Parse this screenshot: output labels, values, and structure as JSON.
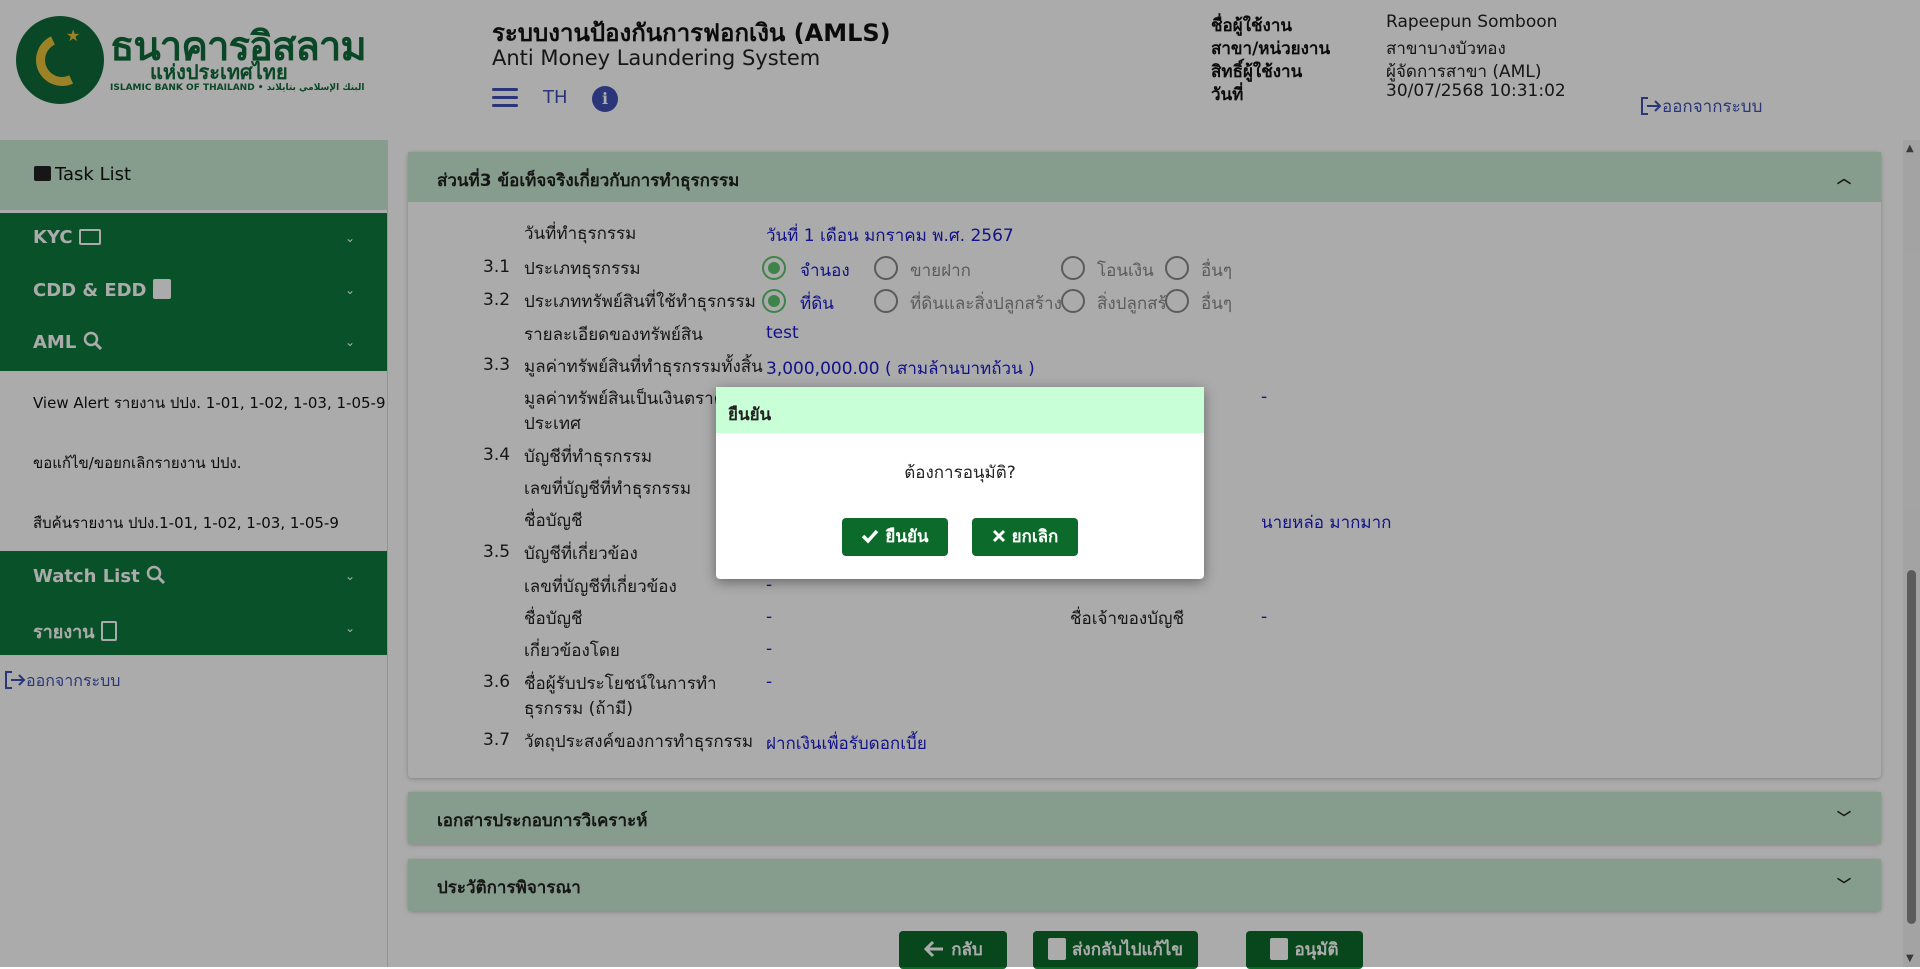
{
  "header": {
    "bank_name_th": "ธนาคารอิสลาม",
    "bank_name_th2": "แห่งประเทศไทย",
    "bank_name_en": "ISLAMIC BANK OF THAILAND • البنك الإسلامي بتايلاند",
    "system_title": "ระบบงานป้องกันการฟอกเงิน (AMLS)",
    "system_subtitle": "Anti Money Laundering System",
    "lang": "TH",
    "info": "i",
    "user_label": "ชื่อผู้ใช้งาน",
    "user_value": "Rapeepun Somboon",
    "branch_label": "สาขา/หน่วยงาน",
    "branch_value": "สาขาบางบัวทอง",
    "role_label": "สิทธิ์ผู้ใช้งาน",
    "role_value": "ผู้จัดการสาขา (AML)",
    "date_label": "วันที่",
    "date_value": "30/07/2568 10:31:02",
    "logout": "ออกจากระบบ"
  },
  "sidebar": {
    "task_list": "Task List",
    "kyc": "KYC",
    "cdd": "CDD & EDD",
    "aml": "AML",
    "aml_items": [
      "View Alert รายงาน ปปง. 1-01, 1-02, 1-03, 1-05-9",
      "ขอแก้ไข/ขอยกเลิกรายงาน ปปง.",
      "สืบค้นรายงาน ปปง.1-01, 1-02, 1-03, 1-05-9"
    ],
    "watch_list": "Watch List",
    "report": "รายงาน",
    "logout": "ออกจากระบบ",
    "chevron": "⌄"
  },
  "section3": {
    "title": "ส่วนที่3 ข้อเท็จจริงเกี่ยวกับการทำธุรกรรม",
    "chev_up": "︿",
    "date_label": "วันที่ทำธุรกรรม",
    "date_value": "วันที่ 1 เดือน มกราคม พ.ศ. 2567",
    "n31": "3.1",
    "l31": "ประเภทธุรกรรม",
    "r31": [
      "จำนอง",
      "ขายฝาก",
      "โอนเงิน",
      "อื่นๆ"
    ],
    "n32": "3.2",
    "l32": "ประเภททรัพย์สินที่ใช้ทำธุรกรรม",
    "r32": [
      "ที่ดิน",
      "ที่ดินและสิ่งปลูกสร้าง",
      "สิ่งปลูกสร้าง",
      "อื่นๆ"
    ],
    "asset_detail_label": "รายละเอียดของทรัพย์สิน",
    "asset_detail_value": "test",
    "n33": "3.3",
    "l33": "มูลค่าทรัพย์สินที่ทำธุรกรรมทั้งสิ้น",
    "v33": "3,000,000.00 ( สามล้านบาทถ้วน )",
    "foreign_label": "มูลค่าทรัพย์สินเป็นเงินตราต่างประเทศ",
    "foreign_value": "-",
    "n34": "3.4",
    "l34": "บัญชีที่ทำธุรกรรม",
    "acc_no_label": "เลขที่บัญชีที่ทำธุรกรรม",
    "acc_name_label": "ชื่อบัญชี",
    "acc_owner_value": "นายหล่อ มากมาก",
    "n35": "3.5",
    "l35": "บัญชีที่เกี่ยวข้อง",
    "rel_acc_no_label": "เลขที่บัญชีที่เกี่ยวข้อง",
    "rel_acc_no_value": "-",
    "rel_acc_name_label": "ชื่อบัญชี",
    "rel_acc_name_value": "-",
    "rel_owner_label": "ชื่อเจ้าของบัญชี",
    "rel_owner_value": "-",
    "related_by_label": "เกี่ยวข้องโดย",
    "related_by_value": "-",
    "n36": "3.6",
    "l36": "ชื่อผู้รับประโยชน์ในการทำธุรกรรม (ถ้ามี)",
    "v36": "-",
    "n37": "3.7",
    "l37": "วัตถุประสงค์ของการทำธุรกรรม",
    "v37": "ฝากเงินเพื่อรับดอกเบี้ย"
  },
  "panels": {
    "docs": "เอกสารประกอบการวิเคราะห์",
    "history": "ประวัติการพิจารณา",
    "chev_down": "﹀"
  },
  "actions": {
    "back": "กลับ",
    "send_back": "ส่งกลับไปแก้ไข",
    "approve": "อนุมัติ"
  },
  "modal": {
    "title": "ยืนยัน",
    "message": "ต้องการอนุมัติ?",
    "confirm": "ยืนยัน",
    "cancel": "ยกเลิก"
  },
  "colors": {
    "brand_green": "#0e7a3c",
    "light_green": "#c8ebd2",
    "link_blue": "#3f51b5",
    "value_blue": "#1a1acc"
  }
}
